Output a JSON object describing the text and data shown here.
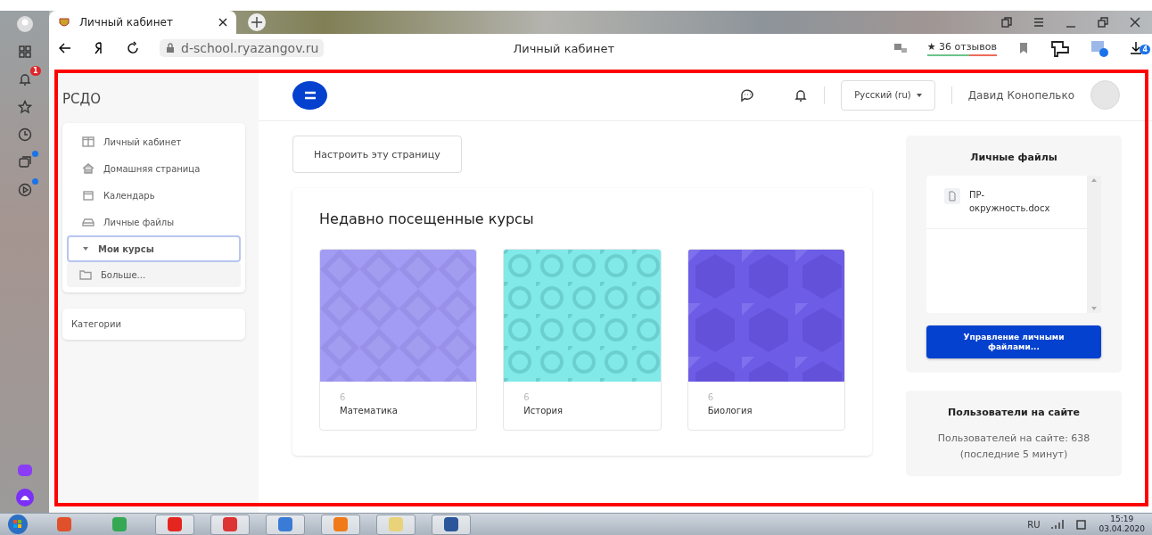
{
  "browser": {
    "tab_title": "Личный кабинет",
    "url": "d-school.ryazangov.ru",
    "page_title": "Личный кабинет",
    "reviews": "★ 36 отзывов",
    "notification_badge": "1",
    "downloads_badge": "4"
  },
  "sidebar": {
    "brand": "РСДО",
    "items": [
      {
        "label": "Личный кабинет",
        "selected": false
      },
      {
        "label": "Домашняя страница",
        "selected": false
      },
      {
        "label": "Календарь",
        "selected": false
      },
      {
        "label": "Личные файлы",
        "selected": false
      },
      {
        "label": "Мои курсы",
        "selected": true,
        "expanded": true,
        "children": [
          {
            "label": "Больше...",
            "selected": false
          }
        ]
      }
    ],
    "categories": "Категории"
  },
  "navbar": {
    "language": "Русский (ru)",
    "user": "Давид Конопелько"
  },
  "customize_button": "Настроить эту страницу",
  "recent_courses": {
    "title": "Недавно посещенные курсы",
    "courses": [
      {
        "category": "6",
        "name": "Математика",
        "kind": "diamonds",
        "color": "#a39cf4"
      },
      {
        "category": "6",
        "name": "История",
        "kind": "rings",
        "color": "#81e9e8"
      },
      {
        "category": "6",
        "name": "Биология",
        "kind": "polygons",
        "color": "#6d5ce6"
      }
    ]
  },
  "private_files": {
    "title": "Личные файлы",
    "files": [
      {
        "name": "ПР-окружность.docx"
      }
    ],
    "button": "Управление личными файлами..."
  },
  "online_users": {
    "title": "Пользователи на сайте",
    "count_text": "Пользователей на сайте: 638",
    "note": "(последние 5 минут)"
  },
  "taskbar": {
    "language": "RU",
    "time": "15:19",
    "date": "03.04.2020"
  }
}
